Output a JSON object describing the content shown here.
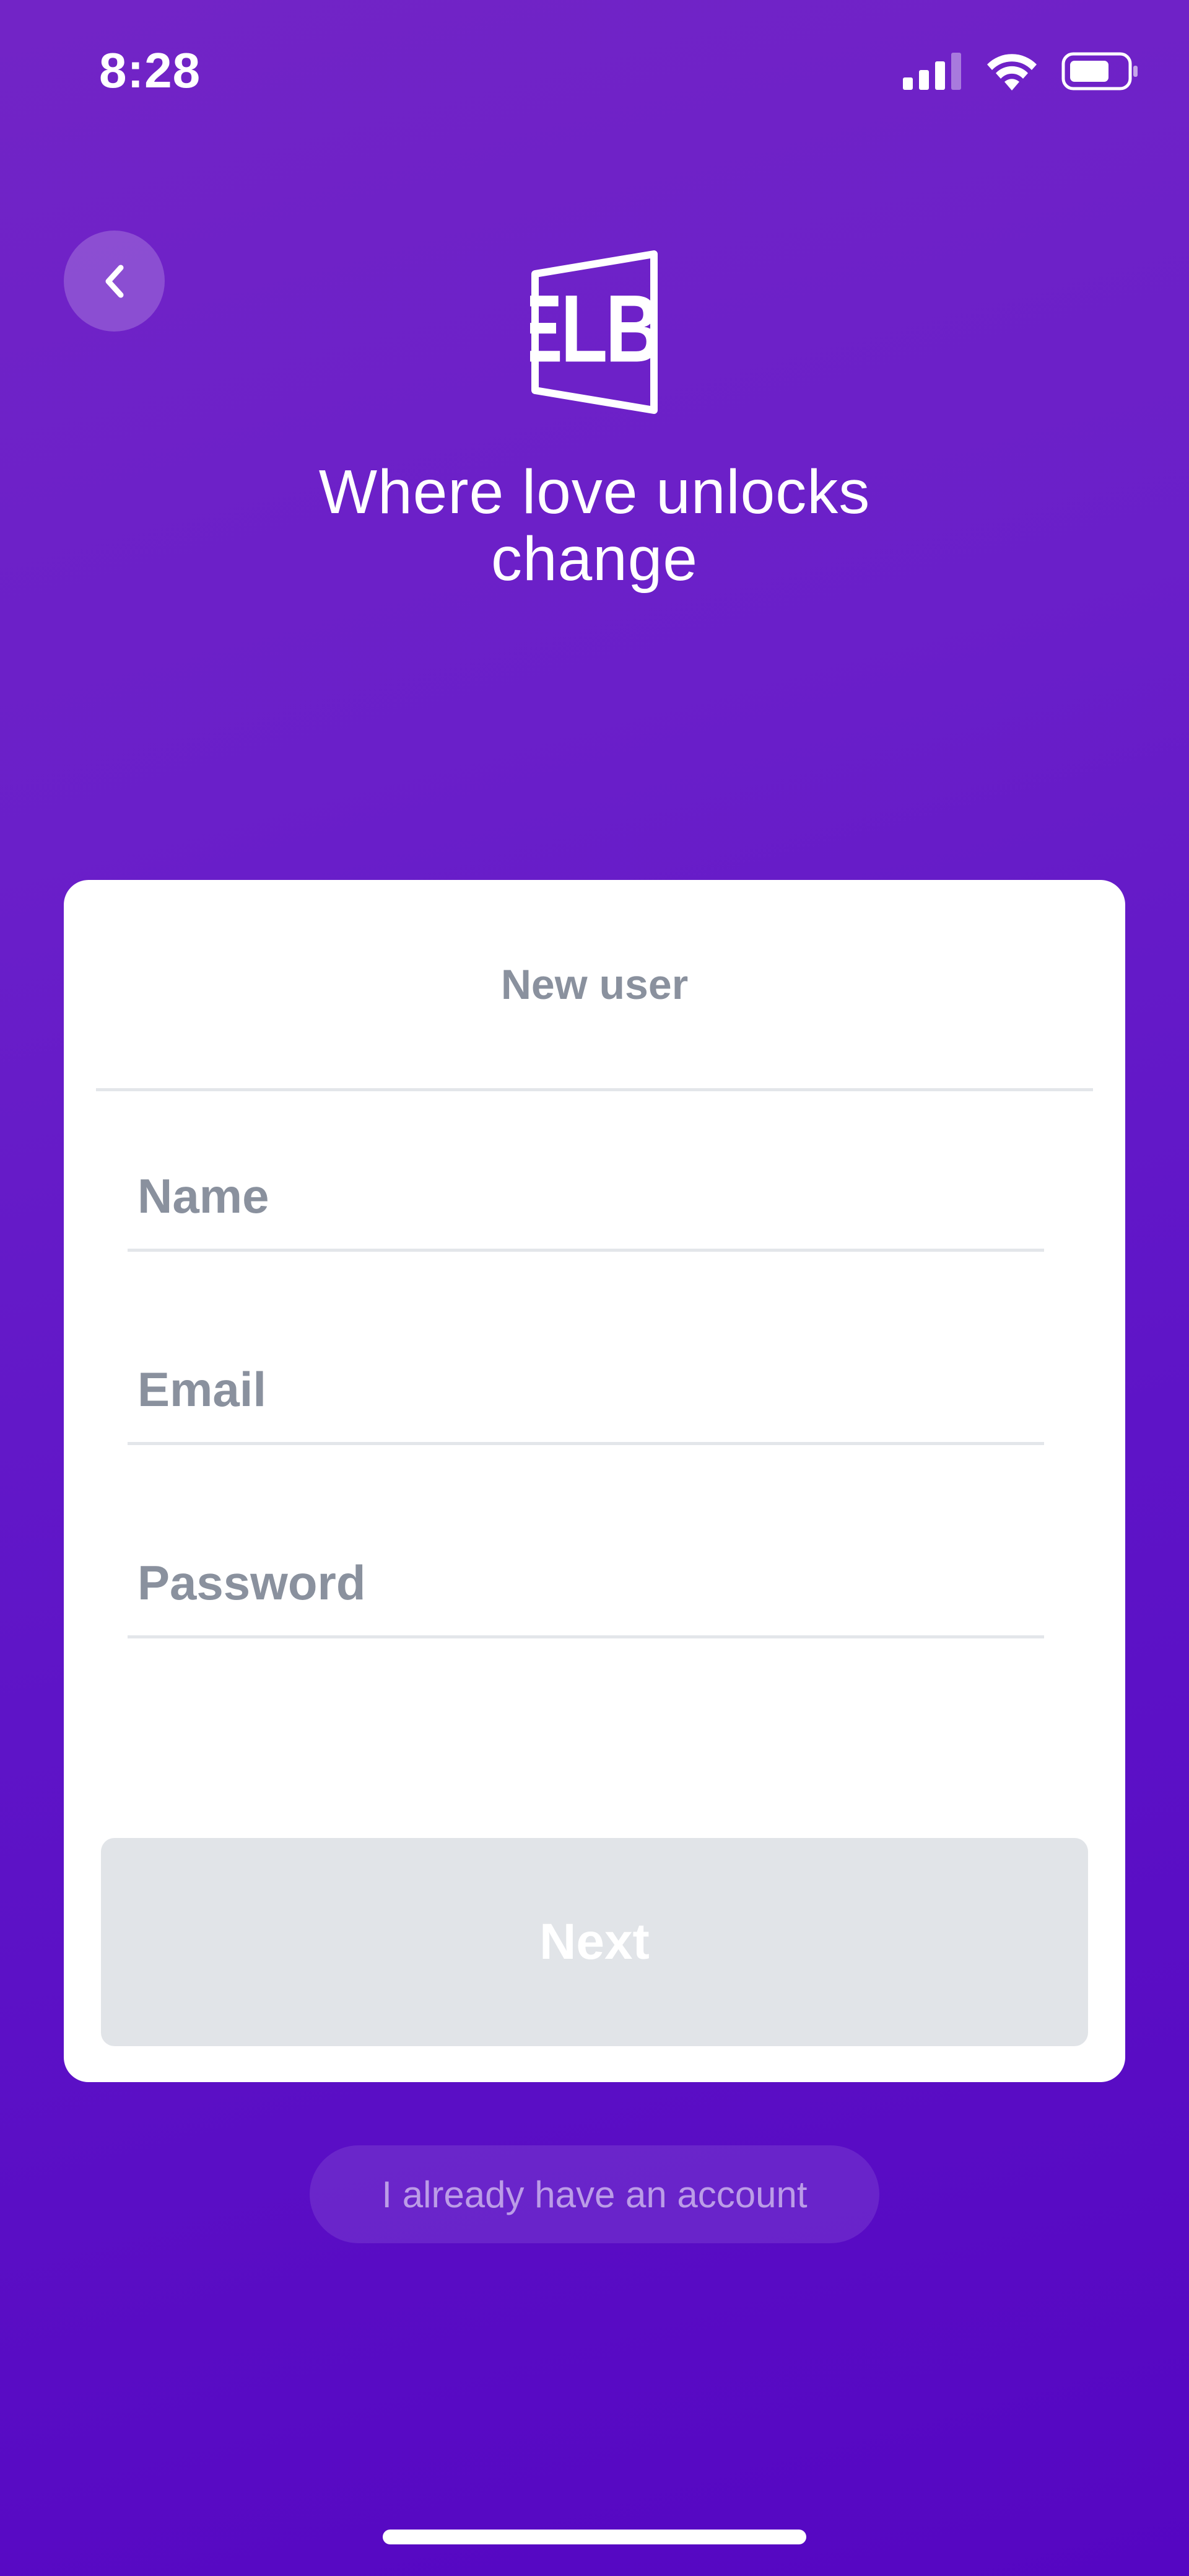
{
  "status_bar": {
    "time": "8:28"
  },
  "brand": {
    "logo_text": "ELBI",
    "tagline": "Where love unlocks change"
  },
  "form": {
    "title": "New user",
    "name_placeholder": "Name",
    "email_placeholder": "Email",
    "password_placeholder": "Password",
    "next_label": "Next"
  },
  "footer": {
    "account_label": "I already have an account"
  },
  "colors": {
    "background_top": "#7224c6",
    "background_bottom": "#5506c2",
    "card": "#ffffff",
    "placeholder": "#8a919e",
    "button_disabled": "#e1e4e8"
  }
}
